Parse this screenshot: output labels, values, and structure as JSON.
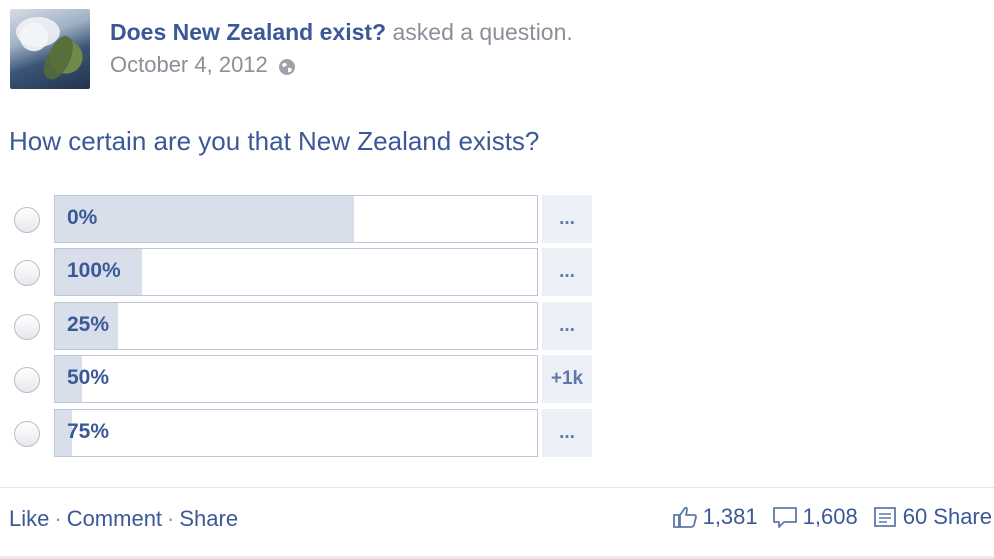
{
  "post": {
    "author": "Does New Zealand exist?",
    "action": "asked a question.",
    "date": "October 4, 2012",
    "privacy_icon": "globe-icon",
    "avatar_icon": "satellite-image-avatar"
  },
  "question": "How certain are you that New Zealand exists?",
  "poll": {
    "options": [
      {
        "label": "0%",
        "vote_share": 0.62,
        "more": "..."
      },
      {
        "label": "100%",
        "vote_share": 0.18,
        "more": "..."
      },
      {
        "label": "25%",
        "vote_share": 0.13,
        "more": "..."
      },
      {
        "label": "50%",
        "vote_share": 0.055,
        "more": "+1k"
      },
      {
        "label": "75%",
        "vote_share": 0.035,
        "more": "..."
      }
    ]
  },
  "actions": {
    "like": "Like",
    "comment": "Comment",
    "share": "Share",
    "separator": "·"
  },
  "stats": {
    "likes": "1,381",
    "comments": "1,608",
    "shares": "60 Share",
    "like_icon": "thumbs-up-icon",
    "comment_icon": "comment-bubble-icon",
    "share_icon": "share-icon"
  },
  "colors": {
    "link": "#3b5998",
    "muted": "#8a8f99",
    "bar_fill": "#d8dfea",
    "bar_border": "#bcc6d8"
  }
}
